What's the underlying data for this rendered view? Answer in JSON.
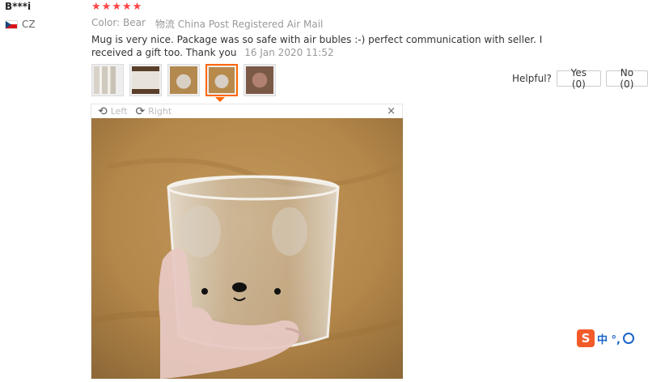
{
  "reviewer": {
    "name": "B***i",
    "country_code": "CZ"
  },
  "rating": {
    "stars": 5,
    "max": 5,
    "color": "#ff4747"
  },
  "order": {
    "color_label": "Color:",
    "color_value": "Bear",
    "shipping_label": "物流",
    "shipping_value": "China Post Registered Air Mail"
  },
  "review": {
    "text": "Mug is very nice. Package was so safe with air bubles :-) perfect communication with seller. I received a gift too. Thank you",
    "date": "16 Jan 2020 11:52"
  },
  "thumbnails": [
    {
      "icon": "photo-thumbnail-bubble-wrap"
    },
    {
      "icon": "photo-thumbnail-package"
    },
    {
      "icon": "photo-thumbnail-mug"
    },
    {
      "icon": "photo-thumbnail-mug-hand",
      "active": true
    },
    {
      "icon": "photo-thumbnail-gift"
    }
  ],
  "helpful": {
    "label": "Helpful?",
    "yes_label": "Yes (0)",
    "no_label": "No (0)"
  },
  "viewer": {
    "rotate_left_label": "Left",
    "rotate_right_label": "Right",
    "close_glyph": "×"
  },
  "ime": {
    "logo": "S",
    "mode_text": "中 °,"
  },
  "colors": {
    "accent": "#ff6600",
    "star": "#ff4747",
    "muted": "#999999"
  }
}
